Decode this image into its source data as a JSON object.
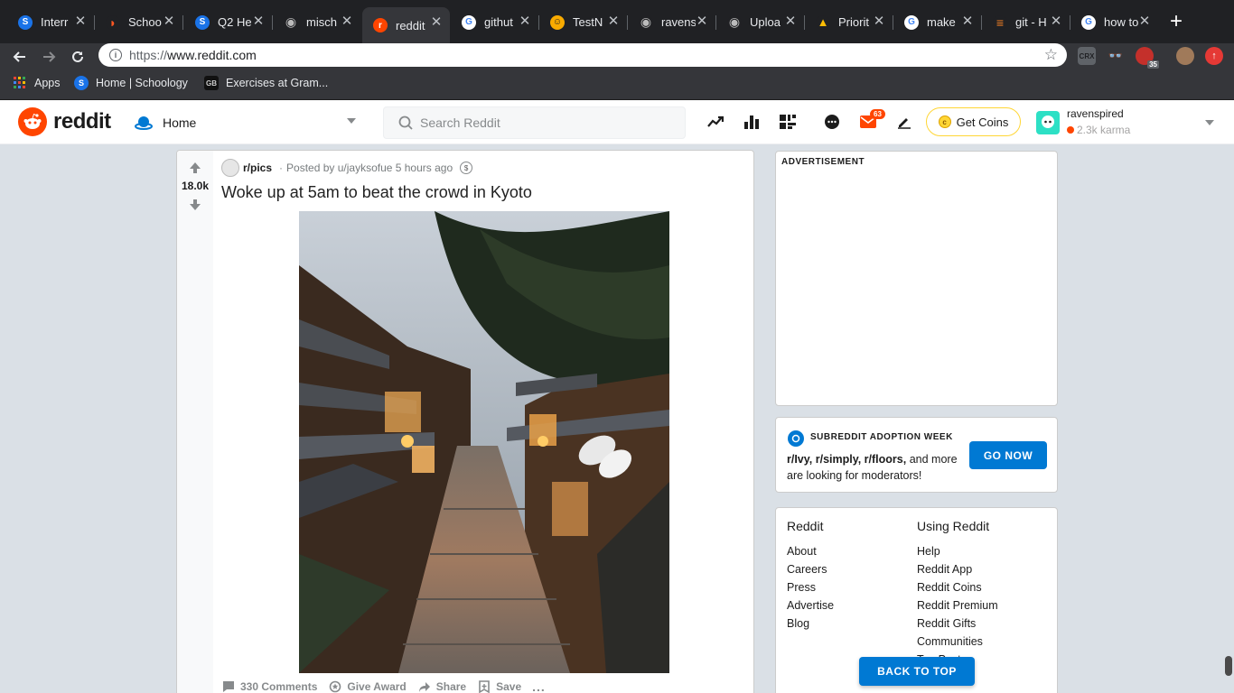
{
  "browser": {
    "tabs": [
      {
        "title": "Interr",
        "favicon": "S",
        "color": "#1a73e8"
      },
      {
        "title": "Schoo",
        "favicon": "◗",
        "color": "#ff5722"
      },
      {
        "title": "Q2 He",
        "favicon": "S",
        "color": "#1a73e8"
      },
      {
        "title": "misch",
        "favicon": "◉",
        "color": "#3c3c3c"
      },
      {
        "title": "reddit",
        "favicon": "r",
        "color": "#ff4500"
      },
      {
        "title": "githut",
        "favicon": "G",
        "color": "#ffffff"
      },
      {
        "title": "TestN",
        "favicon": "☺",
        "color": "#f9ab00"
      },
      {
        "title": "ravens",
        "favicon": "◉",
        "color": "#3c3c3c"
      },
      {
        "title": "Uploa",
        "favicon": "◉",
        "color": "#3c3c3c"
      },
      {
        "title": "Priorit",
        "favicon": "▲",
        "color": "#0f9d58"
      },
      {
        "title": "make",
        "favicon": "G",
        "color": "#ffffff"
      },
      {
        "title": "git - H",
        "favicon": "≡",
        "color": "#f48024"
      },
      {
        "title": "how to",
        "favicon": "G",
        "color": "#ffffff"
      }
    ],
    "address": {
      "prefix": "https://",
      "host": "www.reddit.com"
    },
    "bookmarks": [
      {
        "label": "Apps"
      },
      {
        "label": "Home | Schoology"
      },
      {
        "label": "Exercises at Gram..."
      }
    ],
    "extensions": {
      "crx": "CRX",
      "abp_count": "35"
    }
  },
  "reddit": {
    "logo": "reddit",
    "home_label": "Home",
    "search_placeholder": "Search Reddit",
    "mail_badge": "63",
    "coins_label": "Get Coins",
    "user": {
      "name": "ravenspired",
      "karma": "2.3k karma"
    }
  },
  "post": {
    "subreddit": "r/pics",
    "posted_by": "Posted by u/jayksofue 5 hours ago",
    "score": "18.0k",
    "title": "Woke up at 5am to beat the crowd in Kyoto",
    "actions": {
      "comments": "330 Comments",
      "award": "Give Award",
      "share": "Share",
      "save": "Save",
      "more": "..."
    }
  },
  "sidebar": {
    "ad_label": "ADVERTISEMENT",
    "adoption": {
      "heading": "SUBREDDIT ADOPTION WEEK",
      "subs": "r/Ivy, r/simply, r/floors,",
      "text": " and more are looking for moderators!",
      "button": "GO NOW"
    },
    "links": {
      "col1_title": "Reddit",
      "col1": [
        "About",
        "Careers",
        "Press",
        "Advertise",
        "Blog"
      ],
      "col2_title": "Using Reddit",
      "col2": [
        "Help",
        "Reddit App",
        "Reddit Coins",
        "Reddit Premium",
        "Reddit Gifts",
        "Communities",
        "Top Posts"
      ]
    },
    "back_to_top": "BACK TO TOP"
  },
  "colors": {
    "reddit_orange": "#ff4500",
    "reddit_blue": "#0079d3",
    "coins_gold": "#ffd635",
    "page_bg": "#dae0e6"
  }
}
